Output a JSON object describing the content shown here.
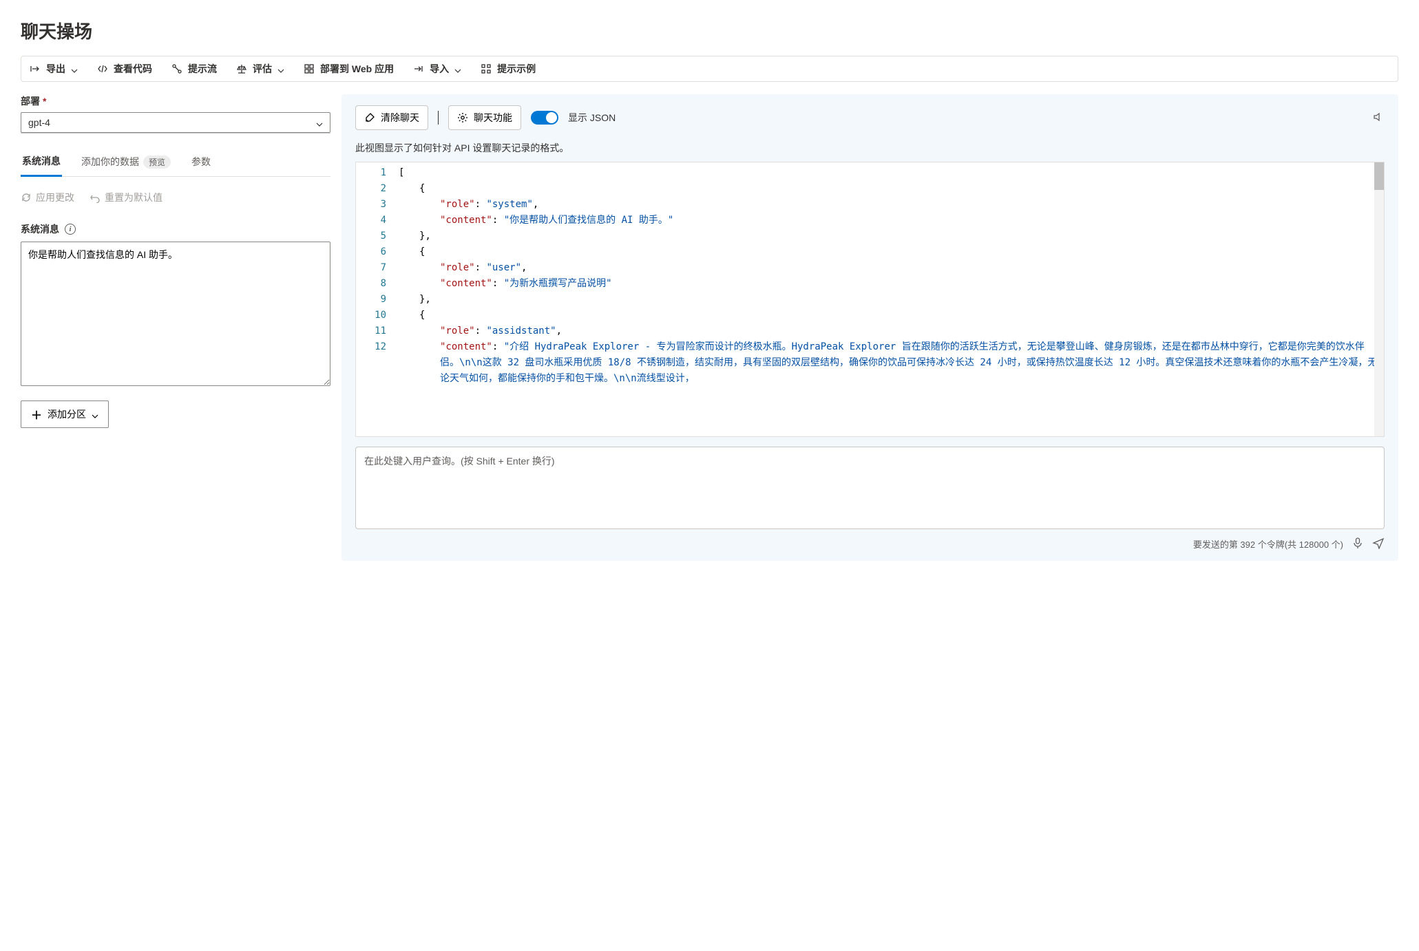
{
  "page_title": "聊天操场",
  "toolbar": {
    "export": "导出",
    "view_code": "查看代码",
    "prompt_flow": "提示流",
    "evaluate": "评估",
    "deploy_web": "部署到 Web 应用",
    "import": "导入",
    "prompt_examples": "提示示例"
  },
  "left": {
    "deploy_label": "部署",
    "deploy_value": "gpt-4",
    "tabs": {
      "system_message": "系统消息",
      "add_your_data": "添加你的数据",
      "preview_badge": "预览",
      "parameters": "参数"
    },
    "apply_changes": "应用更改",
    "reset_default": "重置为默认值",
    "system_message_label": "系统消息",
    "system_message_value": "你是帮助人们查找信息的 AI 助手。",
    "add_section": "添加分区"
  },
  "right": {
    "clear_chat": "清除聊天",
    "chat_features": "聊天功能",
    "show_json": "显示 JSON",
    "show_json_on": true,
    "description": "此视图显示了如何针对 API 设置聊天记录的格式。",
    "json_lines": [
      {
        "n": 1,
        "indent": 0,
        "raw": "["
      },
      {
        "n": 2,
        "indent": 1,
        "raw": "{"
      },
      {
        "n": 3,
        "indent": 2,
        "kv": {
          "k": "\"role\"",
          "v": "\"system\"",
          "trail": ","
        }
      },
      {
        "n": 4,
        "indent": 2,
        "kv": {
          "k": "\"content\"",
          "v": "\"你是帮助人们查找信息的 AI 助手。\"",
          "trail": ""
        }
      },
      {
        "n": 5,
        "indent": 1,
        "raw": "},"
      },
      {
        "n": 6,
        "indent": 1,
        "raw": "{"
      },
      {
        "n": 7,
        "indent": 2,
        "kv": {
          "k": "\"role\"",
          "v": "\"user\"",
          "trail": ","
        }
      },
      {
        "n": 8,
        "indent": 2,
        "kv": {
          "k": "\"content\"",
          "v": "\"为新水瓶撰写产品说明\"",
          "trail": ""
        }
      },
      {
        "n": 9,
        "indent": 1,
        "raw": "},"
      },
      {
        "n": 10,
        "indent": 1,
        "raw": "{"
      },
      {
        "n": 11,
        "indent": 2,
        "kv": {
          "k": "\"role\"",
          "v": "\"assidstant\"",
          "trail": ","
        }
      },
      {
        "n": 12,
        "indent": 2,
        "kv": {
          "k": "\"content\"",
          "v": "\"介绍 HydraPeak Explorer - 专为冒险家而设计的终极水瓶。HydraPeak Explorer 旨在跟随你的活跃生活方式，无论是攀登山峰、健身房锻炼，还是在都市丛林中穿行，它都是你完美的饮水伴侣。\\n\\n这款 32 盘司水瓶采用优质 18/8 不锈钢制造，结实耐用，具有坚固的双层壁结构，确保你的饮品可保持冰冷长达 24 小时，或保持热饮温度长达 12 小时。真空保温技术还意味着你的水瓶不会产生冷凝，无论天气如何，都能保持你的手和包干燥。\\n\\n流线型设计，",
          "trail": ""
        }
      }
    ],
    "chat_placeholder": "在此处键入用户查询。(按 Shift + Enter 换行)",
    "token_count_text": "要发送的第 392 个令牌(共 128000 个)"
  }
}
